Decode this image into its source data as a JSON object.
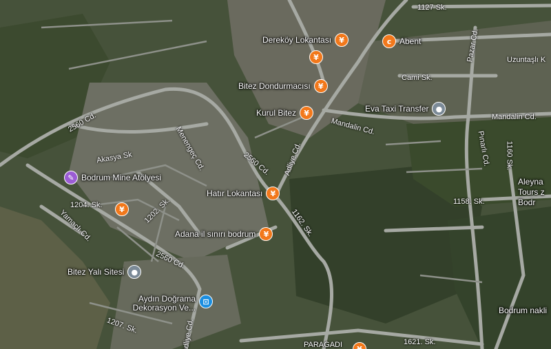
{
  "streets": {
    "s1127": "1127 Sk.",
    "pazar": "Pazar Cd.",
    "uzuntasli": "Uzuntaşlı K",
    "cami": "Cami Sk.",
    "mandalin_left": "Mandalin Cd.",
    "mandalin_right": "Mandalin Cd.",
    "s2560_top": "2560 Cd.",
    "menengec": "Menengeç Cd.",
    "akasya": "Akasya Sk",
    "s2560_mid": "2560 Cd.",
    "adliye_top": "Adliye Cd.",
    "pinarli": "Pınarlı Cd.",
    "s1160": "1160 Sk.",
    "s1204": "1204. Sk.",
    "s1202": "1202. Sk.",
    "yamacli": "Yamaçlı Cd.",
    "s1162": "1162. Sk.",
    "s1158": "1158. Sk.",
    "s2560_bot": "2560 Cd.",
    "s1207": "1207. Sk.",
    "adliye_bot": "Adliye Cd.",
    "s1621": "1621. Sk.",
    "paragadi": "PARAGADI"
  },
  "pois": {
    "derekoy": "Dereköy Lokantası",
    "abent": "Abent",
    "bitez_dondurma": "Bitez Dondurmacısı",
    "kurul": "Kurul Bitez",
    "eva_taxi": "Eva Taxi Transfer",
    "bodrum_mine": "Bodrum Mine Atölyesi",
    "hatir": "Hatır Lokantası",
    "adana": "Adana il sınırı bodrum",
    "bitez_yali": "Bitez Yalı Sitesi",
    "aydin": "Aydın Doğrama Dekorasyon Ve...",
    "aleyna": "Aleyna Tours z Bodr",
    "bodrum_nakli": "Bodrum nakli"
  },
  "colors": {
    "food": "#f2781b",
    "shop": "#1a8ee0",
    "art": "#9b5cd4",
    "generic": "#7b8a97"
  },
  "icons": {
    "food": "fork-knife-icon",
    "cafe": "cup-icon",
    "taxi": "dot-icon",
    "art": "palette-icon",
    "shop": "bag-icon"
  }
}
